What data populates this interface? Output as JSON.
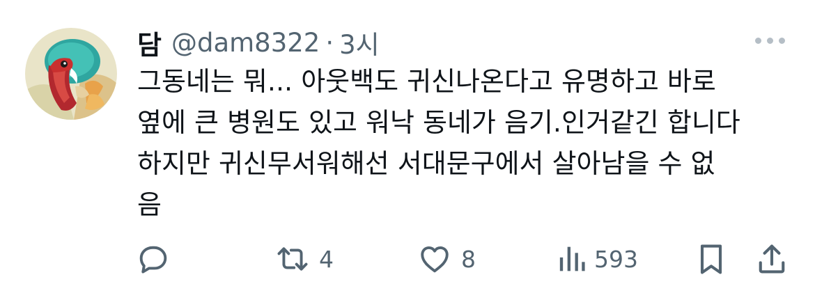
{
  "author": {
    "display_name": "담",
    "handle": "@dam8322",
    "separator": "·",
    "time": "3시"
  },
  "tweet": {
    "lines": [
      "그동네는 뭐... 아웃백도 귀신나온다고 유명하고 바로",
      "옆에 큰 병원도 있고 워낙 동네가 음기.인거같긴 합니다",
      "하지만 귀신무서워해선 서대문구에서 살아남을 수 없",
      "음"
    ]
  },
  "actions": {
    "reply_icon": "reply-icon",
    "retweet_icon": "retweet-icon",
    "retweet_count": "4",
    "like_icon": "heart-icon",
    "like_count": "8",
    "views_icon": "views-icon",
    "views_count": "593",
    "bookmark_icon": "bookmark-icon",
    "share_icon": "share-icon"
  },
  "colors": {
    "text": "#0f1419",
    "secondary": "#536471",
    "more_dots": "#b5bec6"
  }
}
